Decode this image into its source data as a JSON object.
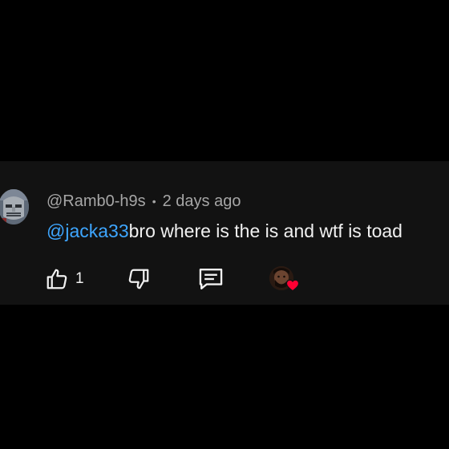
{
  "comment": {
    "author": "@Ramb0-h9s",
    "separator": "•",
    "timestamp": "2 days ago",
    "mention": "@jacka33",
    "body": "bro where is the is and wtf is toad",
    "like_count": "1"
  },
  "icons": {
    "like": "thumbs-up-icon",
    "dislike": "thumbs-down-icon",
    "reply": "reply-icon",
    "heart": "heart-icon"
  },
  "colors": {
    "background": "#000000",
    "card": "#121212",
    "mention": "#3ea6ff",
    "text": "#f1f1f1",
    "meta": "#a6a6a6",
    "heart": "#ff0033"
  }
}
